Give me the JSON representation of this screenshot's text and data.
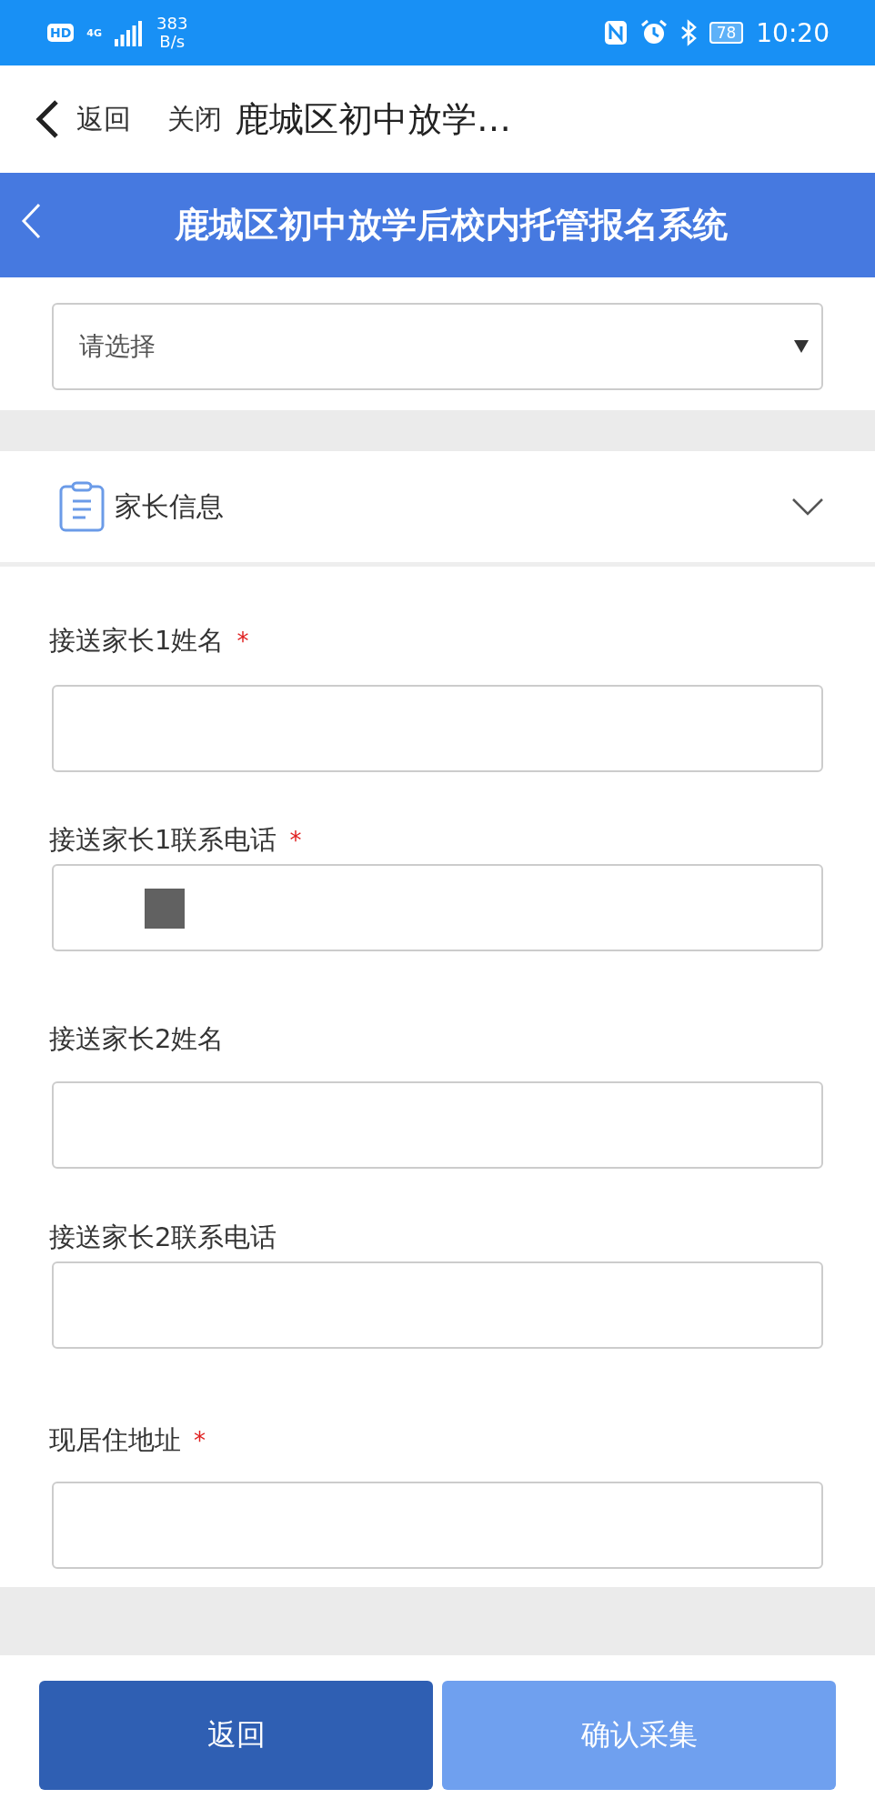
{
  "status_bar": {
    "hd": "HD",
    "network": "4G",
    "speed": "383",
    "speed_unit": "B/s",
    "battery": "78",
    "time": "10:20"
  },
  "nav_bar": {
    "back": "返回",
    "close": "关闭",
    "title": "鹿城区初中放学…"
  },
  "header": {
    "title": "鹿城区初中放学后校内托管报名系统"
  },
  "select": {
    "placeholder": "请选择"
  },
  "section": {
    "title": "家长信息",
    "expanded": true
  },
  "fields": [
    {
      "label": "接送家长1姓名",
      "required_mark": "*",
      "redacted": false
    },
    {
      "label": "接送家长1联系电话",
      "required_mark": "*",
      "redacted": true
    },
    {
      "label": "接送家长2姓名",
      "redacted": false
    },
    {
      "label": "接送家长2联系电话",
      "redacted": false
    },
    {
      "label": "现居住地址",
      "required_mark": "*",
      "redacted": false
    }
  ],
  "buttons": [
    {
      "label": "返回",
      "kind": "back"
    },
    {
      "label": "确认采集",
      "kind": "confirm"
    }
  ]
}
